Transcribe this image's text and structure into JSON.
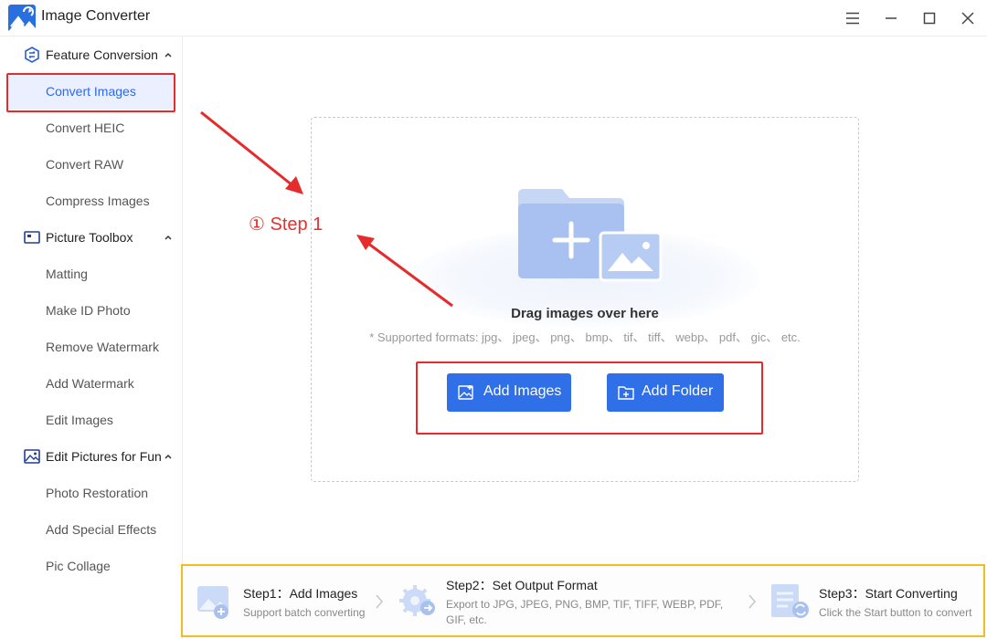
{
  "app": {
    "title": "Image Converter",
    "logo_icon": "image-converter-logo-icon"
  },
  "window_controls": [
    "menu-icon",
    "minimize-icon",
    "maximize-icon",
    "close-icon"
  ],
  "sidebar": {
    "sections": [
      {
        "label": "Feature Conversion",
        "icon": "hexagon-swap-icon",
        "expanded": true,
        "items": [
          {
            "label": "Convert Images",
            "active": true
          },
          {
            "label": "Convert HEIC"
          },
          {
            "label": "Convert RAW"
          },
          {
            "label": "Compress Images"
          }
        ]
      },
      {
        "label": "Picture Toolbox",
        "icon": "toolbox-icon",
        "expanded": true,
        "items": [
          {
            "label": "Matting"
          },
          {
            "label": "Make ID Photo"
          },
          {
            "label": "Remove Watermark"
          },
          {
            "label": "Add Watermark"
          },
          {
            "label": "Edit Images"
          }
        ]
      },
      {
        "label": "Edit Pictures for Fun",
        "icon": "picture-edit-icon",
        "expanded": true,
        "items": [
          {
            "label": "Photo Restoration"
          },
          {
            "label": "Add Special Effects"
          },
          {
            "label": "Pic Collage"
          }
        ]
      }
    ]
  },
  "dropzone": {
    "title": "Drag images over here",
    "formats": "* Supported formats: jpg、 jpeg、 png、 bmp、 tif、 tiff、 webp、 pdf、 gic、 etc.",
    "add_images_label": "Add Images",
    "add_folder_label": "Add Folder"
  },
  "annotation": {
    "step_label": "① Step 1",
    "color": "#e52b2b"
  },
  "steps": [
    {
      "title": "Step1：Add Images",
      "desc": "Support batch converting"
    },
    {
      "title": "Step2：Set Output Format",
      "desc": "Export to JPG, JPEG, PNG, BMP, TIF, TIFF, WEBP, PDF, GIF, etc."
    },
    {
      "title": "Step3：Start Converting",
      "desc": "Click the Start button to convert"
    }
  ],
  "colors": {
    "accent": "#2f6fe8",
    "active_bg": "#eaf0ff",
    "steps_border": "#f2bb1f"
  }
}
